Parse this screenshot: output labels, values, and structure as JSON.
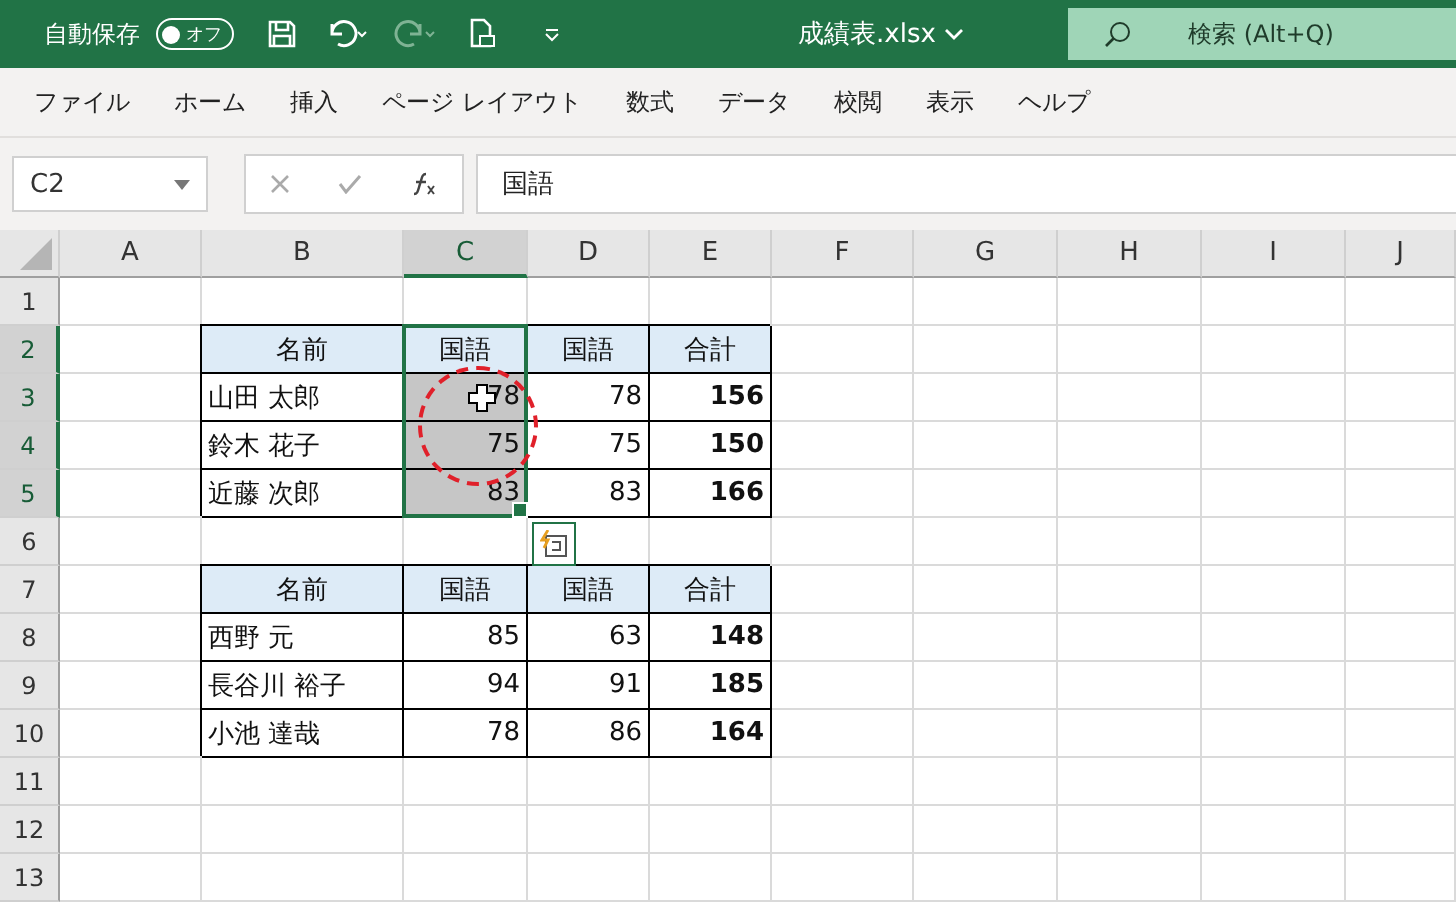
{
  "titlebar": {
    "autosave_label": "自動保存",
    "autosave_toggle": {
      "label": "オフ",
      "on": false
    },
    "file_name": "成績表.xlsx",
    "search": {
      "placeholder": "検索 (Alt+Q)"
    }
  },
  "menu": [
    {
      "label": "ファイル"
    },
    {
      "label": "ホーム"
    },
    {
      "label": "挿入"
    },
    {
      "label": "ページ レイアウト"
    },
    {
      "label": "数式"
    },
    {
      "label": "データ"
    },
    {
      "label": "校閲"
    },
    {
      "label": "表示"
    },
    {
      "label": "ヘルプ"
    }
  ],
  "formula_bar": {
    "name_box": "C2",
    "formula": "国語"
  },
  "columns": [
    {
      "label": "A",
      "selected": false
    },
    {
      "label": "B",
      "selected": false
    },
    {
      "label": "C",
      "selected": true
    },
    {
      "label": "D",
      "selected": false
    },
    {
      "label": "E",
      "selected": false
    },
    {
      "label": "F",
      "selected": false
    },
    {
      "label": "G",
      "selected": false
    },
    {
      "label": "H",
      "selected": false
    },
    {
      "label": "I",
      "selected": false
    },
    {
      "label": "J",
      "selected": false
    }
  ],
  "rows": [
    {
      "label": "1",
      "selected": false,
      "cells": {}
    },
    {
      "label": "2",
      "selected": true,
      "cells": {
        "B": {
          "text": "名前",
          "kind": "head",
          "selected": false
        },
        "C": {
          "text": "国語",
          "kind": "head",
          "selected": false
        },
        "D": {
          "text": "国語",
          "kind": "head",
          "selected": false
        },
        "E": {
          "text": "合計",
          "kind": "head",
          "selected": false
        }
      }
    },
    {
      "label": "3",
      "selected": true,
      "cells": {
        "B": {
          "text": "山田 太郎",
          "kind": "name",
          "selected": false
        },
        "C": {
          "text": "78",
          "kind": "num",
          "selected": true
        },
        "D": {
          "text": "78",
          "kind": "num",
          "selected": false
        },
        "E": {
          "text": "156",
          "kind": "total",
          "selected": false
        }
      }
    },
    {
      "label": "4",
      "selected": true,
      "cells": {
        "B": {
          "text": "鈴木 花子",
          "kind": "name",
          "selected": false
        },
        "C": {
          "text": "75",
          "kind": "num",
          "selected": true
        },
        "D": {
          "text": "75",
          "kind": "num",
          "selected": false
        },
        "E": {
          "text": "150",
          "kind": "total",
          "selected": false
        }
      }
    },
    {
      "label": "5",
      "selected": true,
      "cells": {
        "B": {
          "text": "近藤 次郎",
          "kind": "name",
          "selected": false
        },
        "C": {
          "text": "83",
          "kind": "num",
          "selected": true
        },
        "D": {
          "text": "83",
          "kind": "num",
          "selected": false
        },
        "E": {
          "text": "166",
          "kind": "total",
          "selected": false
        }
      }
    },
    {
      "label": "6",
      "selected": false,
      "cells": {}
    },
    {
      "label": "7",
      "selected": false,
      "cells": {
        "B": {
          "text": "名前",
          "kind": "head",
          "selected": false
        },
        "C": {
          "text": "国語",
          "kind": "head",
          "selected": false
        },
        "D": {
          "text": "国語",
          "kind": "head",
          "selected": false
        },
        "E": {
          "text": "合計",
          "kind": "head",
          "selected": false
        }
      }
    },
    {
      "label": "8",
      "selected": false,
      "cells": {
        "B": {
          "text": "西野 元",
          "kind": "name",
          "selected": false
        },
        "C": {
          "text": "85",
          "kind": "num",
          "selected": false
        },
        "D": {
          "text": "63",
          "kind": "num",
          "selected": false
        },
        "E": {
          "text": "148",
          "kind": "total",
          "selected": false
        }
      }
    },
    {
      "label": "9",
      "selected": false,
      "cells": {
        "B": {
          "text": "長谷川 裕子",
          "kind": "name",
          "selected": false
        },
        "C": {
          "text": "94",
          "kind": "num",
          "selected": false
        },
        "D": {
          "text": "91",
          "kind": "num",
          "selected": false
        },
        "E": {
          "text": "185",
          "kind": "total",
          "selected": false
        }
      }
    },
    {
      "label": "10",
      "selected": false,
      "cells": {
        "B": {
          "text": "小池 達哉",
          "kind": "name",
          "selected": false
        },
        "C": {
          "text": "78",
          "kind": "num",
          "selected": false
        },
        "D": {
          "text": "86",
          "kind": "num",
          "selected": false
        },
        "E": {
          "text": "164",
          "kind": "total",
          "selected": false
        }
      }
    },
    {
      "label": "11",
      "selected": false,
      "cells": {}
    },
    {
      "label": "12",
      "selected": false,
      "cells": {}
    },
    {
      "label": "13",
      "selected": false,
      "cells": {}
    }
  ]
}
